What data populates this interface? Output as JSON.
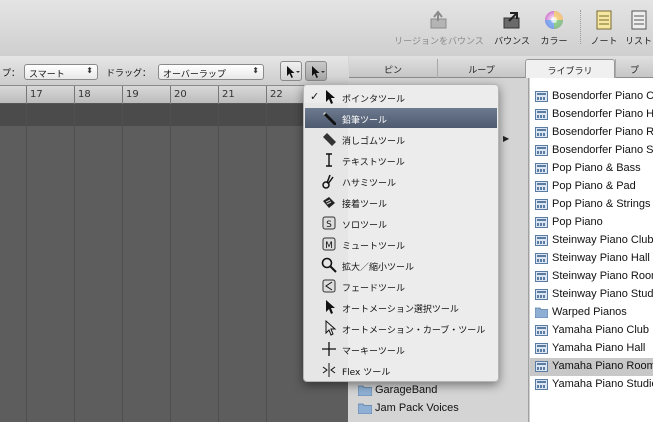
{
  "toolbar": {
    "region_bounce": "リージョンをバウンス",
    "bounce": "バウンス",
    "color": "カラー",
    "note": "ノート",
    "list": "リスト"
  },
  "tools": {
    "mode_label": "プ：",
    "mode_value": "スマート",
    "drag_label": "ドラッグ：",
    "drag_value": "オーバーラップ"
  },
  "ruler": [
    "17",
    "18",
    "19",
    "20",
    "21",
    "22"
  ],
  "tabs": [
    "ピン",
    "ループ",
    "ライブラリ",
    "プ"
  ],
  "library": {
    "left_items": [
      {
        "label": "GarageBand",
        "icon": "folder-icon"
      },
      {
        "label": "Jam Pack Voices",
        "icon": "folder-icon"
      }
    ],
    "right_items": [
      {
        "label": "Bosendorfer Piano Cl",
        "icon": "patch-icon"
      },
      {
        "label": "Bosendorfer Piano Ha",
        "icon": "patch-icon"
      },
      {
        "label": "Bosendorfer Piano Ro",
        "icon": "patch-icon"
      },
      {
        "label": "Bosendorfer Piano St",
        "icon": "patch-icon"
      },
      {
        "label": "Pop Piano & Bass",
        "icon": "patch-icon"
      },
      {
        "label": "Pop Piano & Pad",
        "icon": "patch-icon"
      },
      {
        "label": "Pop Piano & Strings",
        "icon": "patch-icon"
      },
      {
        "label": "Pop Piano",
        "icon": "patch-icon"
      },
      {
        "label": "Steinway Piano Club",
        "icon": "patch-icon"
      },
      {
        "label": "Steinway Piano Hall",
        "icon": "patch-icon"
      },
      {
        "label": "Steinway Piano Room",
        "icon": "patch-icon"
      },
      {
        "label": "Steinway Piano Studio",
        "icon": "patch-icon"
      },
      {
        "label": "Warped Pianos",
        "icon": "folder-icon"
      },
      {
        "label": "Yamaha Piano Club",
        "icon": "patch-icon"
      },
      {
        "label": "Yamaha Piano Hall",
        "icon": "patch-icon"
      },
      {
        "label": "Yamaha Piano Room",
        "icon": "patch-icon"
      },
      {
        "label": "Yamaha Piano Studio",
        "icon": "patch-icon"
      }
    ],
    "selected_right": "Yamaha Piano Room"
  },
  "menu": {
    "items": [
      {
        "label": "ポインタツール",
        "icon": "pointer-icon",
        "checked": true
      },
      {
        "label": "鉛筆ツール",
        "icon": "pencil-icon",
        "highlighted": true
      },
      {
        "label": "消しゴムツール",
        "icon": "eraser-icon"
      },
      {
        "label": "テキストツール",
        "icon": "text-cursor-icon"
      },
      {
        "label": "ハサミツール",
        "icon": "scissors-icon"
      },
      {
        "label": "接着ツール",
        "icon": "glue-icon"
      },
      {
        "label": "ソロツール",
        "icon": "solo-icon"
      },
      {
        "label": "ミュートツール",
        "icon": "mute-icon"
      },
      {
        "label": "拡大／縮小ツール",
        "icon": "zoom-icon"
      },
      {
        "label": "フェードツール",
        "icon": "fade-icon"
      },
      {
        "label": "オートメーション選択ツール",
        "icon": "automation-select-icon"
      },
      {
        "label": "オートメーション・カーブ・ツール",
        "icon": "automation-curve-icon"
      },
      {
        "label": "マーキーツール",
        "icon": "marquee-icon"
      },
      {
        "label": "Flex ツール",
        "icon": "flex-icon"
      }
    ]
  }
}
